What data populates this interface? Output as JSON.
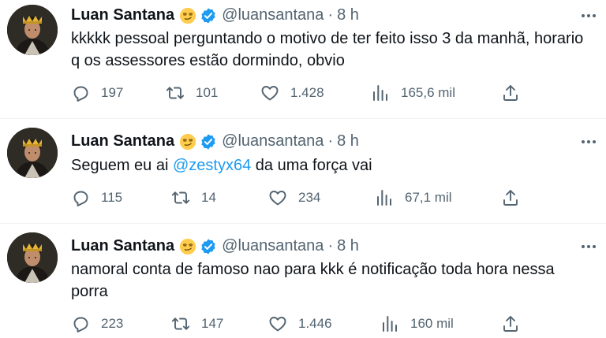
{
  "tweets": [
    {
      "name": "Luan Santana",
      "handle": "@luansantana",
      "dot": "·",
      "time": "8 h",
      "text_parts": [
        "kkkkk pessoal perguntando o motivo de ter feito isso 3 da manhã, horario q os assessores estão dormindo, obvio"
      ],
      "replies": "197",
      "retweets": "101",
      "likes": "1.428",
      "views": "165,6 mil"
    },
    {
      "name": "Luan Santana",
      "handle": "@luansantana",
      "dot": "·",
      "time": "8 h",
      "text_before": "Seguem eu ai ",
      "mention": "@zestyx64",
      "text_after": " da uma força vai",
      "replies": "115",
      "retweets": "14",
      "likes": "234",
      "views": "67,1 mil"
    },
    {
      "name": "Luan Santana",
      "handle": "@luansantana",
      "dot": "·",
      "time": "8 h",
      "text": "namoral conta de famoso nao para kkk é notificação toda hora nessa porra",
      "replies": "223",
      "retweets": "147",
      "likes": "1.446",
      "views": "160 mil"
    }
  ],
  "colors": {
    "accent": "#1d9bf0",
    "secondary_text": "#536471",
    "divider": "#eff3f4"
  },
  "icons": [
    "smirk-emoji-icon",
    "verified-badge-icon",
    "more-icon",
    "reply-icon",
    "retweet-icon",
    "like-icon",
    "views-icon",
    "share-icon"
  ]
}
